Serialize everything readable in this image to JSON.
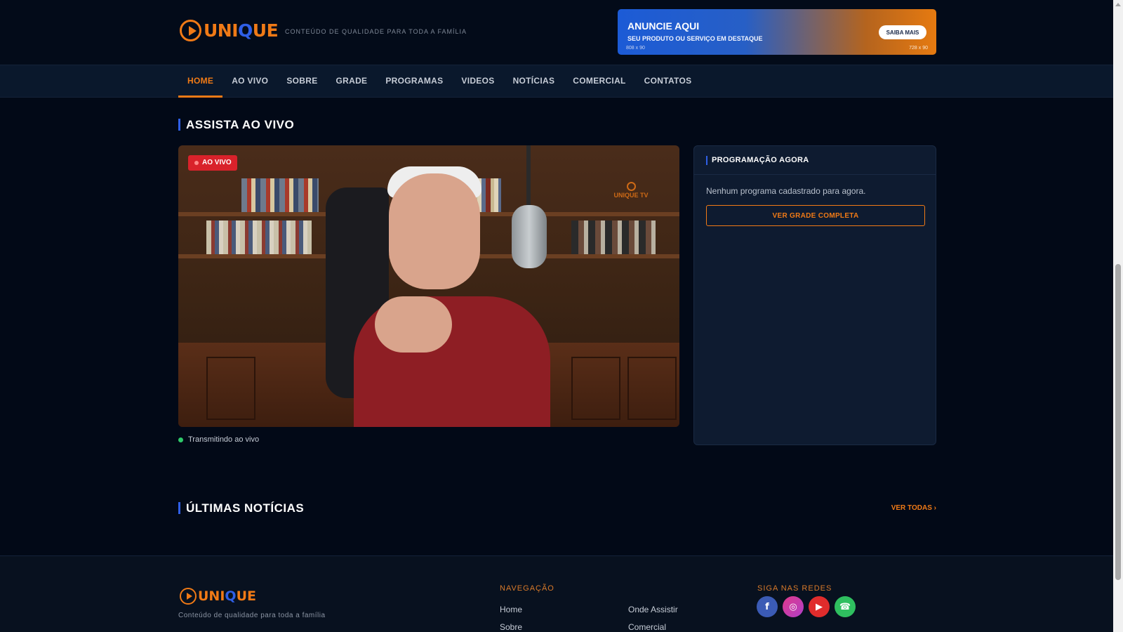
{
  "header": {
    "logo_text_a": "UNI",
    "logo_text_b": "Q",
    "logo_text_c": "UE",
    "tagline": "CONTEÚDO DE QUALIDADE PARA TODA A FAMÍLIA",
    "ad": {
      "title": "ANUNCIE AQUI",
      "subtitle": "SEU PRODUTO OU SERVIÇO EM DESTAQUE",
      "size_left": "808 x 90",
      "size_right": "728 x 90",
      "button": "SAIBA MAIS"
    }
  },
  "nav": {
    "items": [
      {
        "label": "HOME"
      },
      {
        "label": "AO VIVO"
      },
      {
        "label": "SOBRE"
      },
      {
        "label": "GRADE"
      },
      {
        "label": "PROGRAMAS"
      },
      {
        "label": "VIDEOS"
      },
      {
        "label": "NOTÍCIAS"
      },
      {
        "label": "COMERCIAL"
      },
      {
        "label": "CONTATOS"
      }
    ]
  },
  "live": {
    "section_title": "ASSISTA AO VIVO",
    "badge": "AO VIVO",
    "watermark": "UNIQUE TV",
    "status": "Transmitindo ao vivo"
  },
  "schedule": {
    "title": "PROGRAMAÇÃO AGORA",
    "empty_text": "Nenhum programa cadastrado para agora.",
    "button": "VER GRADE COMPLETA"
  },
  "news": {
    "section_title": "ÚLTIMAS NOTÍCIAS",
    "see_all": "VER TODAS ›"
  },
  "footer": {
    "tagline": "Conteúdo de qualidade para toda a família",
    "nav_heading": "NAVEGAÇÃO",
    "links_col1": [
      "Home",
      "Sobre"
    ],
    "links_col2": [
      "Onde Assistir",
      "Comercial"
    ],
    "social_heading": "SIGA NAS REDES",
    "social": [
      {
        "name": "facebook-icon",
        "glyph": "f"
      },
      {
        "name": "instagram-icon",
        "glyph": "◎"
      },
      {
        "name": "youtube-icon",
        "glyph": "▶"
      },
      {
        "name": "whatsapp-icon",
        "glyph": "☎"
      }
    ]
  },
  "colors": {
    "accent": "#f07a16",
    "brand_blue": "#2f5fe6",
    "live_red": "#d9222b",
    "online_green": "#2fca6a"
  }
}
